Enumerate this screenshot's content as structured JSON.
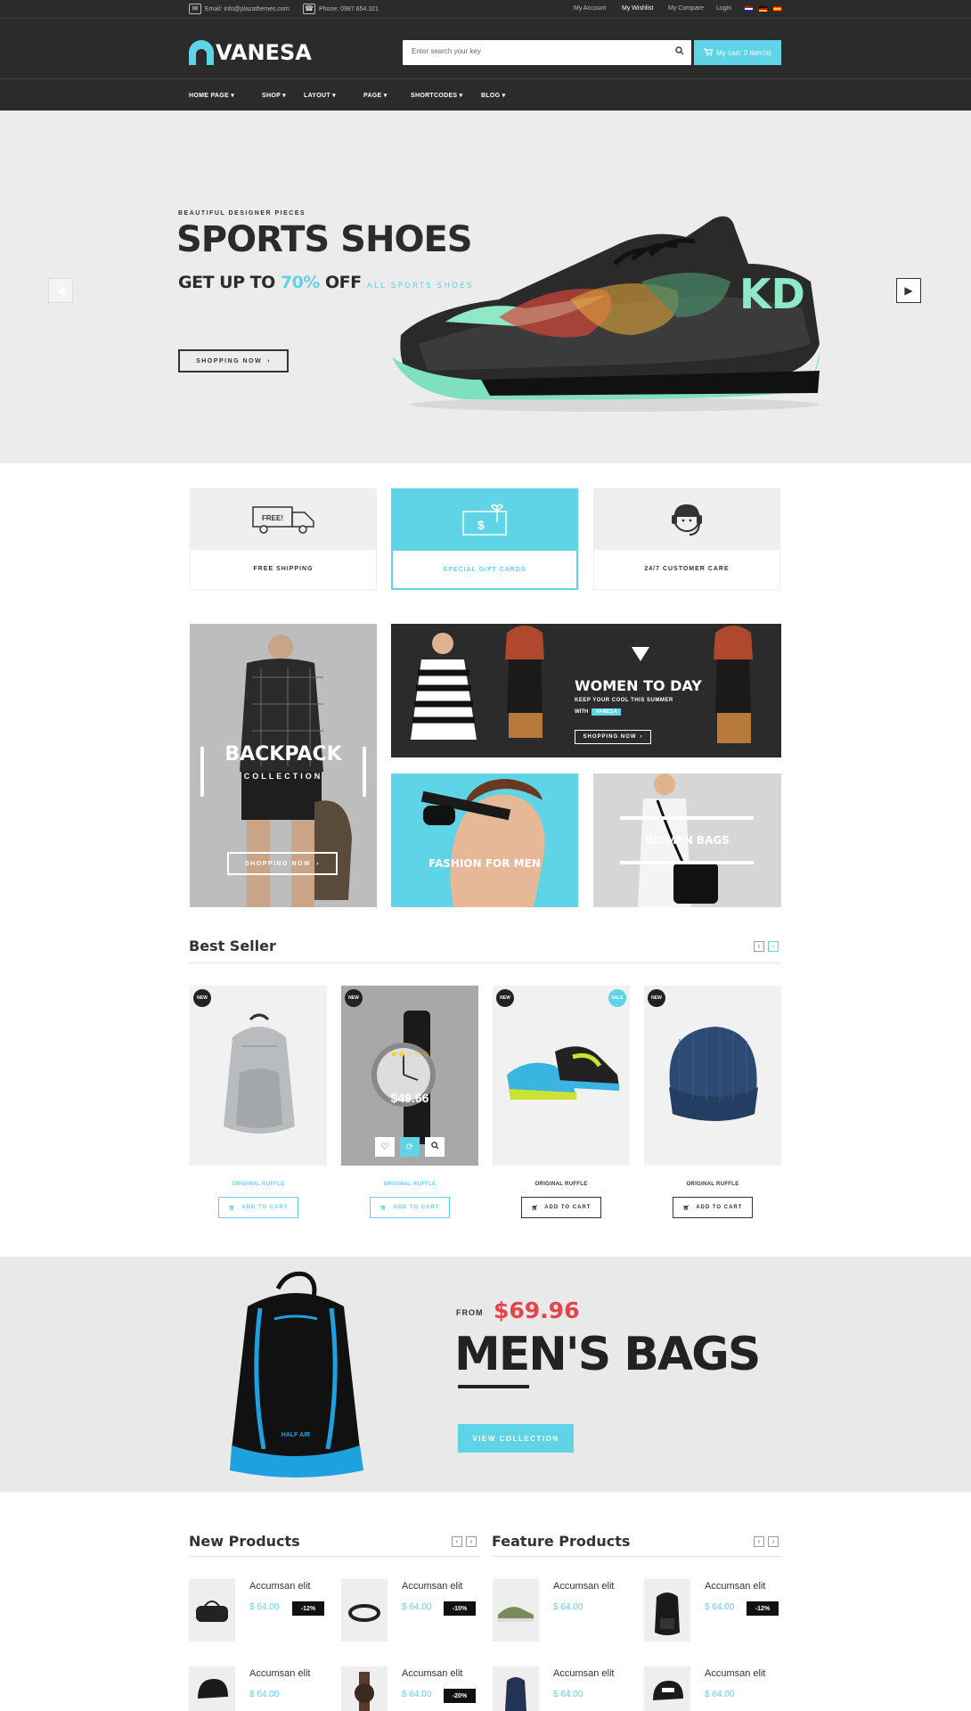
{
  "topbar": {
    "email": "Email: info@plazathemes.com",
    "phone": "Phone: 0987.654.321",
    "links": [
      "My Account",
      "My Wishlist",
      "My Compare",
      "Login"
    ]
  },
  "header": {
    "logo": "VANESA",
    "search_placeholder": "Enter search your key",
    "cart": "My cart: 0 item(s)"
  },
  "nav": {
    "items": [
      "HOME PAGE",
      "SHOP",
      "LAYOUT",
      "PAGE",
      "SHORTCODES",
      "BLOG"
    ]
  },
  "hero": {
    "pretitle": "BEAUTIFUL DESIGNER PIECES",
    "title": "SPORTS SHOES",
    "sub_a": "GET UP TO",
    "sub_pct": "70%",
    "sub_b": "OFF",
    "sub_c": "ALL SPORTS SHOES",
    "button": "SHOPPING NOW"
  },
  "services": [
    {
      "label": "FREE SHIPPING",
      "icon": "truck-icon",
      "truck_text": "FREE!"
    },
    {
      "label": "SPECIAL GIFT CARDS",
      "icon": "gift-card-icon"
    },
    {
      "label": "24/7 CUSTOMER CARE",
      "icon": "headset-icon"
    }
  ],
  "banners": {
    "backpack_title": "BACKPACK",
    "backpack_sub": "COLLECTION",
    "backpack_button": "SHOPPING NOW",
    "women_title": "WOMEN TO DAY",
    "women_sub": "KEEP YOUR COOL THIS SUMMER",
    "women_with": "WITH",
    "women_brand": "VANESA",
    "women_button": "SHOPPING NOW",
    "men_title": "FASHION FOR MEN",
    "bags_title": "WOMEN BAGS"
  },
  "best_seller": {
    "title": "Best Seller",
    "products": [
      {
        "badge": "NEW",
        "name": "ORIGINAL RUFFLE",
        "button": "ADD TO CART",
        "highlight": true
      },
      {
        "badge": "NEW",
        "name": "ORIGINAL RUFFLE",
        "button": "ADD TO CART",
        "highlight": true,
        "hover_price": "$49.66"
      },
      {
        "badge": "NEW",
        "sale": "SALE",
        "name": "ORIGINAL RUFFLE",
        "button": "ADD TO CART",
        "highlight": false
      },
      {
        "badge": "NEW",
        "name": "ORIGINAL RUFFLE",
        "button": "ADD TO CART",
        "highlight": false
      }
    ]
  },
  "promo": {
    "from": "FROM",
    "price": "$69.96",
    "title": "MEN'S BAGS",
    "button": "VIEW COLLECTION",
    "bag_label": "HALF AIR"
  },
  "new_products": {
    "title": "New Products",
    "items": [
      {
        "name": "Accumsan elit",
        "price": "$ 64.00",
        "discount": "-12%"
      },
      {
        "name": "Accumsan elit",
        "price": "$ 64.00",
        "discount": "-10%"
      },
      {
        "name": "Accumsan elit",
        "price": "$ 64.00"
      },
      {
        "name": "Accumsan elit",
        "price": "$ 64.00",
        "discount": "-20%"
      }
    ]
  },
  "feature_products": {
    "title": "Feature Products",
    "items": [
      {
        "name": "Accumsan elit",
        "price": "$ 64.00"
      },
      {
        "name": "Accumsan elit",
        "price": "$ 64.00",
        "discount": "-12%"
      },
      {
        "name": "Accumsan elit",
        "price": "$ 64.00"
      },
      {
        "name": "Accumsan elit",
        "price": "$ 64.00"
      }
    ]
  },
  "colors": {
    "accent": "#5fd4e6",
    "dark": "#2b2b2b",
    "sale": "#e8434a"
  }
}
